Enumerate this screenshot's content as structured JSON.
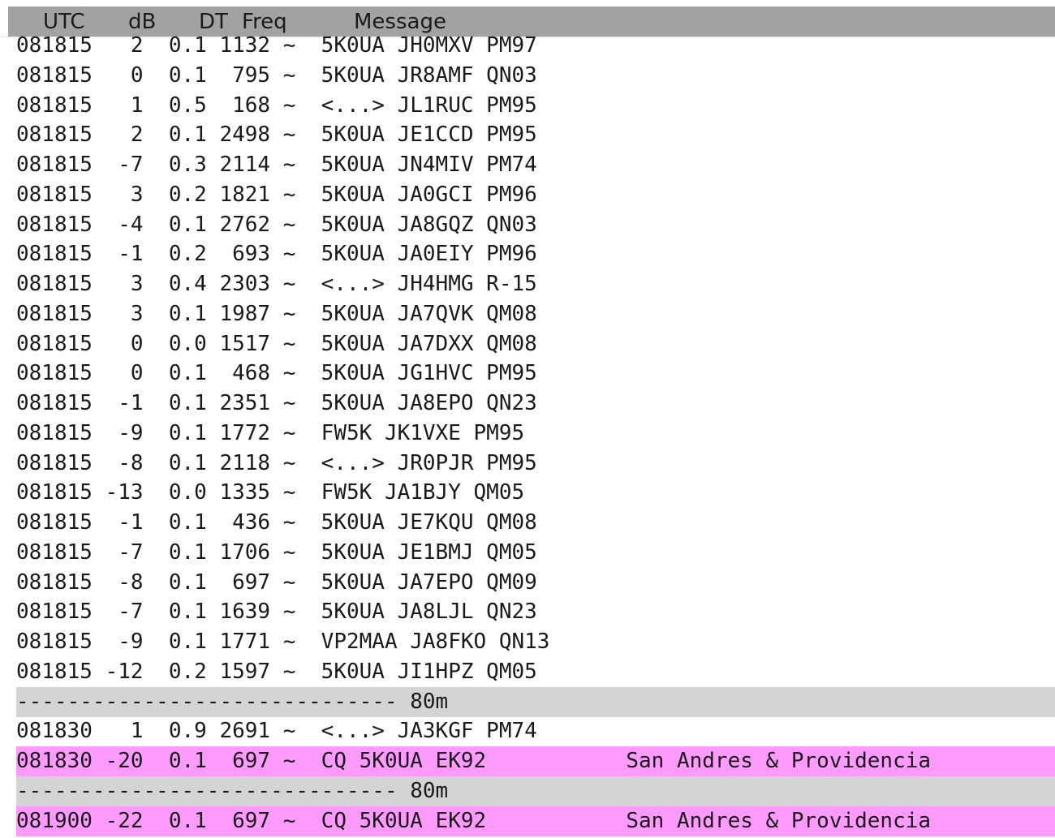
{
  "header": {
    "utc": "UTC",
    "db": "dB",
    "dt": "DT",
    "freq": "Freq",
    "message": "Message"
  },
  "colors": {
    "cq_highlight": "#ff9bff",
    "separator": "#d4d4d4",
    "header_bg": "#a2a2a2"
  },
  "rows": [
    {
      "text": "081815   2  0.1 1132 ~  5K0UA JH0MXV PM97",
      "type": "partial"
    },
    {
      "text": "081815   0  0.1  795 ~  5K0UA JR8AMF QN03",
      "type": "decode"
    },
    {
      "text": "081815   1  0.5  168 ~  <...> JL1RUC PM95",
      "type": "decode"
    },
    {
      "text": "081815   2  0.1 2498 ~  5K0UA JE1CCD PM95",
      "type": "decode"
    },
    {
      "text": "081815  -7  0.3 2114 ~  5K0UA JN4MIV PM74",
      "type": "decode"
    },
    {
      "text": "081815   3  0.2 1821 ~  5K0UA JA0GCI PM96",
      "type": "decode"
    },
    {
      "text": "081815  -4  0.1 2762 ~  5K0UA JA8GQZ QN03",
      "type": "decode"
    },
    {
      "text": "081815  -1  0.2  693 ~  5K0UA JA0EIY PM96",
      "type": "decode"
    },
    {
      "text": "081815   3  0.4 2303 ~  <...> JH4HMG R-15",
      "type": "decode"
    },
    {
      "text": "081815   3  0.1 1987 ~  5K0UA JA7QVK QM08",
      "type": "decode"
    },
    {
      "text": "081815   0  0.0 1517 ~  5K0UA JA7DXX QM08",
      "type": "decode"
    },
    {
      "text": "081815   0  0.1  468 ~  5K0UA JG1HVC PM95",
      "type": "decode"
    },
    {
      "text": "081815  -1  0.1 2351 ~  5K0UA JA8EPO QN23",
      "type": "decode"
    },
    {
      "text": "081815  -9  0.1 1772 ~  FW5K JK1VXE PM95",
      "type": "decode"
    },
    {
      "text": "081815  -8  0.1 2118 ~  <...> JR0PJR PM95",
      "type": "decode"
    },
    {
      "text": "081815 -13  0.0 1335 ~  FW5K JA1BJY QM05",
      "type": "decode"
    },
    {
      "text": "081815  -1  0.1  436 ~  5K0UA JE7KQU QM08",
      "type": "decode"
    },
    {
      "text": "081815  -7  0.1 1706 ~  5K0UA JE1BMJ QM05",
      "type": "decode"
    },
    {
      "text": "081815  -8  0.1  697 ~  5K0UA JA7EPO QM09",
      "type": "decode"
    },
    {
      "text": "081815  -7  0.1 1639 ~  5K0UA JA8LJL QN23",
      "type": "decode"
    },
    {
      "text": "081815  -9  0.1 1771 ~  VP2MAA JA8FKO QN13",
      "type": "decode"
    },
    {
      "text": "081815 -12  0.2 1597 ~  5K0UA JI1HPZ QM05",
      "type": "decode"
    },
    {
      "text": "------------------------------ 80m",
      "type": "separator"
    },
    {
      "text": "081830   1  0.9 2691 ~  <...> JA3KGF PM74",
      "type": "decode"
    },
    {
      "text": "081830 -20  0.1  697 ~  CQ 5K0UA EK92           San Andres & Providencia",
      "type": "cq"
    },
    {
      "text": "------------------------------ 80m",
      "type": "separator"
    },
    {
      "text": "081900 -22  0.1  697 ~  CQ 5K0UA EK92           San Andres & Providencia",
      "type": "cq"
    }
  ]
}
